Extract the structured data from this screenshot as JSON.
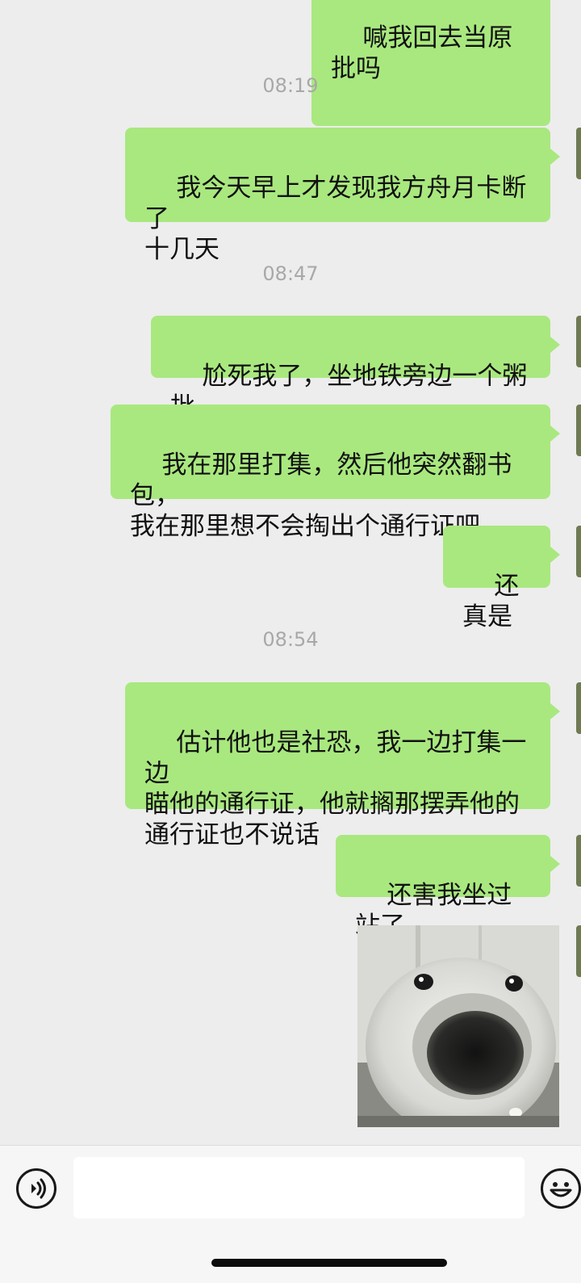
{
  "chat": {
    "messages": [
      {
        "id": "m0",
        "text": "喊我回去当原批吗"
      },
      {
        "id": "ts1",
        "type": "time",
        "text": "08:19"
      },
      {
        "id": "m1",
        "text": "我今天早上才发现我方舟月卡断了\n十几天"
      },
      {
        "id": "ts2",
        "type": "time",
        "text": "08:47"
      },
      {
        "id": "m2",
        "text": "尬死我了，坐地铁旁边一个粥批"
      },
      {
        "id": "m3",
        "text": "我在那里打集，然后他突然翻书包，\n我在那里想不会掏出个通行证吧"
      },
      {
        "id": "m4",
        "text": "还真是"
      },
      {
        "id": "ts3",
        "type": "time",
        "text": "08:54"
      },
      {
        "id": "m5",
        "text": "估计他也是社恐，我一边打集一边\n瞄他的通行证，他就搁那摆弄他的\n通行证也不说话"
      },
      {
        "id": "m6",
        "text": "还害我坐过站了"
      },
      {
        "id": "m7",
        "type": "image",
        "subject": "white-dog-closeup"
      }
    ]
  },
  "input_bar": {
    "voice_icon": "voice-icon",
    "emoji_icon": "emoji-icon",
    "input_value": ""
  },
  "colors": {
    "background": "#ededed",
    "outgoing_bubble": "#a9e87f",
    "timestamp": "#a8a8a8",
    "input_bar": "#f6f6f6"
  }
}
